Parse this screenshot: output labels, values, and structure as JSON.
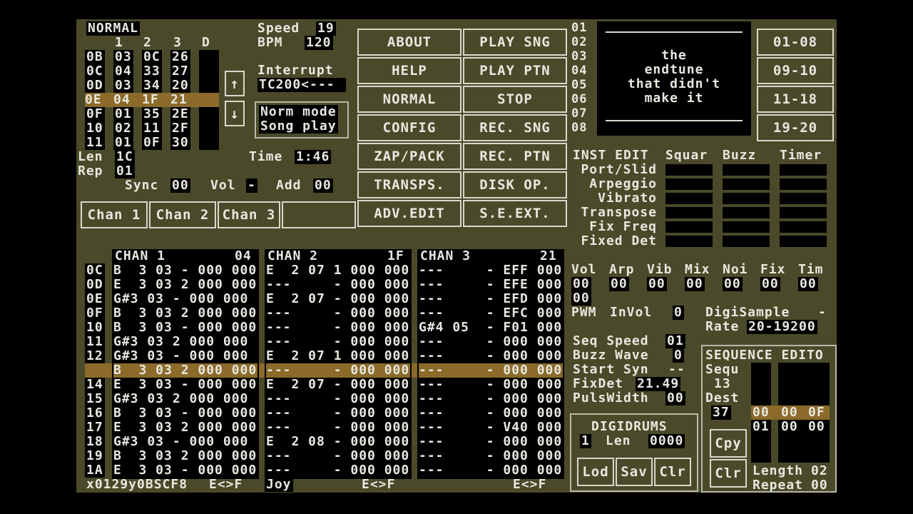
{
  "status": {
    "mode": "NORMAL",
    "channel_header": [
      "1",
      "2",
      "3",
      "D"
    ],
    "speed_label": "Speed",
    "speed_value": "19",
    "bpm_label": "BPM",
    "bpm_value": "120",
    "interrupt_label": "Interrupt",
    "interrupt_value": "TC200<---",
    "mode_box_line1": "Norm mode",
    "mode_box_line2": "Song play",
    "time_label": "Time",
    "time_value": "1:46",
    "len_label": "Len",
    "len_value": "1C",
    "rep_label": "Rep",
    "rep_value": "01",
    "sync_label": "Sync",
    "sync_value": "00",
    "vol_label": "Vol",
    "vol_value": "-",
    "add_label": "Add",
    "add_value": "00",
    "up_arrow": "↑",
    "down_arrow": "↓"
  },
  "order_list": {
    "rows": [
      [
        "0B",
        "03",
        "0C",
        "26"
      ],
      [
        "0C",
        "04",
        "33",
        "27"
      ],
      [
        "0D",
        "03",
        "34",
        "20"
      ],
      [
        "0E",
        "04",
        "1F",
        "21"
      ],
      [
        "0F",
        "01",
        "35",
        "2E"
      ],
      [
        "10",
        "02",
        "11",
        "2F"
      ],
      [
        "11",
        "01",
        "0F",
        "30"
      ]
    ],
    "highlight_index": 3
  },
  "channel_buttons": [
    "Chan 1",
    "Chan 2",
    "Chan 3"
  ],
  "menu": [
    "ABOUT",
    "PLAY SNG",
    "HELP",
    "PLAY PTN",
    "NORMAL",
    "STOP",
    "CONFIG",
    "REC. SNG",
    "ZAP/PACK",
    "REC. PTN",
    "TRANSPS.",
    "DISK OP.",
    "ADV.EDIT",
    "S.E.EXT."
  ],
  "song_title": {
    "line_numbers": [
      "01",
      "02",
      "03",
      "04",
      "05",
      "06",
      "07",
      "08"
    ],
    "lines": [
      "the",
      "endtune",
      "that didn't",
      "make it"
    ]
  },
  "pattern_banks": [
    "01-08",
    "09-10",
    "11-18",
    "19-20"
  ],
  "inst_edit": {
    "title": "INST EDIT",
    "params": [
      "Port/Slid",
      "Arpeggio",
      "Vibrato",
      "Transpose",
      "Fix Freq",
      "Fixed Det"
    ],
    "columns": [
      "Squar",
      "Buzz",
      "Timer"
    ]
  },
  "inst_values": {
    "headers": [
      "Vol",
      "Arp",
      "Vib",
      "Mix",
      "Noi",
      "Fix",
      "Tim"
    ],
    "values": [
      "00",
      "00",
      "00",
      "00",
      "00",
      "00",
      "00"
    ],
    "vol_extra": [
      "00",
      "00"
    ],
    "pwm_label": "PWM",
    "invol_label": "InVol",
    "invol_value": "0",
    "digisample_label": "DigiSample",
    "digisample_value": "-",
    "rate_label": "Rate",
    "rate_value": "20-19200",
    "seq_speed_label": "Seq Speed",
    "seq_speed_value": "01",
    "buzz_wave_label": "Buzz Wave",
    "buzz_wave_value": "0",
    "start_syn_label": "Start Syn",
    "start_syn_value": "--",
    "fixdet_label": "FixDet",
    "fixdet_value": "21.49",
    "pulswidth_label": "PulsWidth",
    "pulswidth_value": "00"
  },
  "sequence_edit": {
    "title": "SEQUENCE EDITO",
    "sequ_label": "Sequ",
    "sequ_value": "13",
    "dest_label": "Dest",
    "dest_value": "37",
    "row1": [
      "00",
      "00",
      "0F"
    ],
    "row2": [
      "01",
      "00",
      "00"
    ],
    "cpy_label": "Cpy",
    "clr_label": "Clr",
    "length_label": "Length",
    "length_value": "02",
    "repeat_label": "Repeat",
    "repeat_value": "00"
  },
  "digidrums": {
    "title": "DIGIDRUMS",
    "num": "1",
    "len_label": "Len",
    "len_value": "0000",
    "buttons": [
      "Lod",
      "Sav",
      "Clr"
    ]
  },
  "pattern": {
    "row_numbers": [
      "0C",
      "0D",
      "0E",
      "0F",
      "10",
      "11",
      "12",
      "13",
      "14",
      "15",
      "16",
      "17",
      "18",
      "19",
      "1A"
    ],
    "highlight_index": 7,
    "channels": [
      {
        "name": "CHAN 1",
        "pattern": "04",
        "rows": [
          "B  3 03 - 000 000",
          "E  3 03 2 000 000",
          "G#3 03 - 000 000",
          "B  3 03 2 000 000",
          "B  3 03 - 000 000",
          "G#3 03 2 000 000",
          "G#3 03 - 000 000",
          "B  3 03 2 000 000",
          "E  3 03 - 000 000",
          "G#3 03 2 000 000",
          "B  3 03 - 000 000",
          "E  3 03 2 000 000",
          "G#3 03 - 000 000",
          "B  3 03 2 000 000",
          "E  3 03 - 000 000"
        ]
      },
      {
        "name": "CHAN 2",
        "pattern": "1F",
        "rows": [
          "E  2 07 1 000 000",
          "---     - 000 000",
          "E  2 07 - 000 000",
          "---     - 000 000",
          "---     - 000 000",
          "---     - 000 000",
          "E  2 07 1 000 000",
          "---     - 000 000",
          "E  2 07 - 000 000",
          "---     - 000 000",
          "---     - 000 000",
          "---     - 000 000",
          "E  2 08 - 000 000",
          "---     - 000 000",
          "---     - 000 000"
        ]
      },
      {
        "name": "CHAN 3",
        "pattern": "21",
        "rows": [
          "---     - EFF 000",
          "---     - EFE 000",
          "---     - EFD 000",
          "---     - EFC 000",
          "G#4 05  - F01 000",
          "---     - 000 000",
          "---     - 000 000",
          "---     - 000 000",
          "---     - 000 000",
          "---     - 000 000",
          "---     - 000 000",
          "---     - V40 000",
          "---     - 000 000",
          "---     - 000 000",
          "---     - 000 000"
        ]
      }
    ]
  },
  "footer": {
    "keys": "x0129y0BSCF8",
    "exf1": "E<>F",
    "joy": "Joy",
    "exf2": "E<>F",
    "exf3": "E<>F"
  },
  "colors": {
    "background": "#4a4a2a",
    "highlight": "#8b6a2a",
    "text": "#e8e8e0",
    "field": "#000000"
  }
}
